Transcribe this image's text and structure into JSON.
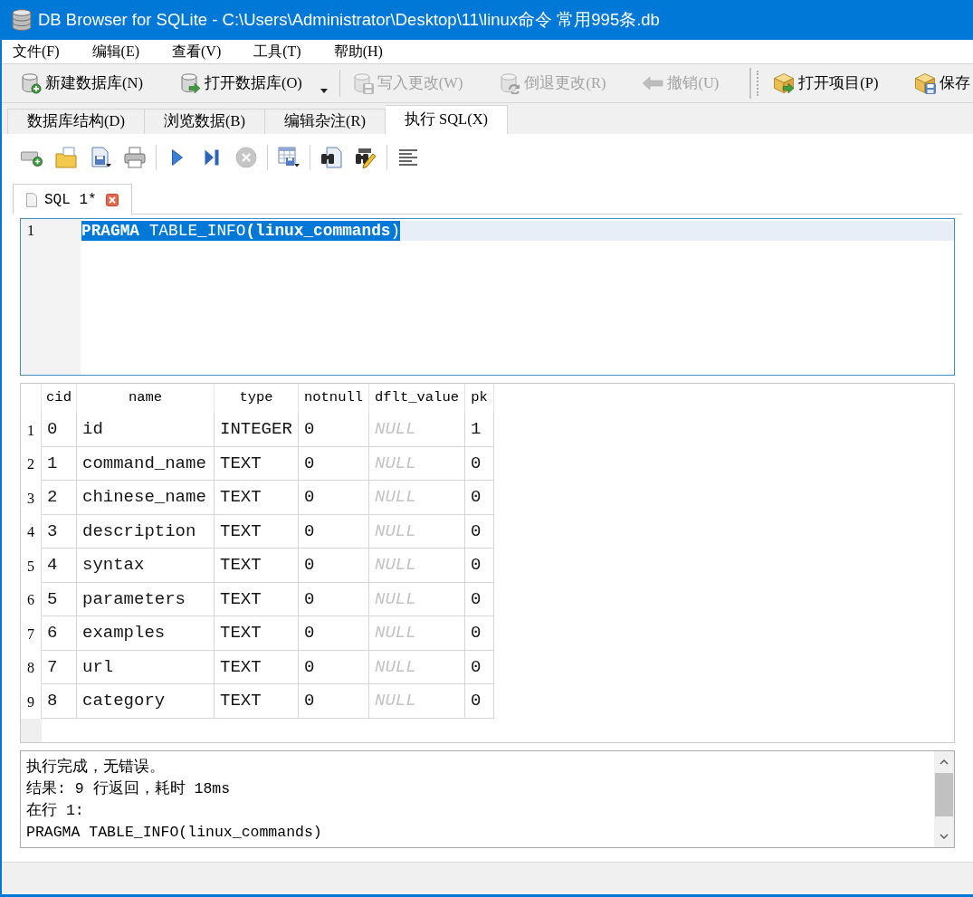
{
  "window": {
    "title": "DB Browser for SQLite - C:\\Users\\Administrator\\Desktop\\11\\linux命令 常用995条.db"
  },
  "menu": [
    "文件(F)",
    "编辑(E)",
    "查看(V)",
    "工具(T)",
    "帮助(H)"
  ],
  "toolbars": [
    {
      "groups": [
        {
          "items": [
            {
              "label": "新建数据库(N)",
              "kind": "button",
              "disabled": false
            },
            {
              "label": "打开数据库(O)",
              "kind": "menu_button",
              "disabled": false
            }
          ]
        },
        {
          "items": [
            {
              "label": "写入更改(W)",
              "kind": "button",
              "disabled": true
            },
            {
              "label": "倒退更改(R)",
              "kind": "button",
              "disabled": true
            },
            {
              "label": "撤销(U)",
              "kind": "button",
              "disabled": true
            }
          ]
        }
      ]
    },
    {
      "groups": [
        {
          "items": [
            {
              "label": "打开项目(P)",
              "kind": "button",
              "disabled": false
            },
            {
              "label": "保存",
              "kind": "button",
              "disabled": false
            }
          ]
        }
      ]
    }
  ],
  "tabs": [
    {
      "label": "数据库结构(D)",
      "selected": false
    },
    {
      "label": "浏览数据(B)",
      "selected": false
    },
    {
      "label": "编辑杂注(R)",
      "selected": false
    },
    {
      "label": "执行 SQL(X)",
      "selected": true
    }
  ],
  "sql_toolbar": [
    {
      "buttons": [
        {
          "disabled": false
        },
        {
          "disabled": false
        },
        {
          "disabled": false
        },
        {
          "disabled": false
        }
      ]
    },
    {
      "buttons": [
        {
          "disabled": false
        },
        {
          "disabled": false
        },
        {
          "disabled": true
        }
      ]
    },
    {
      "buttons": [
        {
          "disabled": false
        }
      ]
    },
    {
      "buttons": [
        {
          "disabled": false
        },
        {
          "disabled": false
        }
      ]
    },
    {
      "buttons": [
        {
          "disabled": false
        }
      ]
    }
  ],
  "editor_tabs": [
    {
      "label": "SQL 1*",
      "selected": true
    }
  ],
  "editor": {
    "lines": [
      {
        "number": "1",
        "text": "**PRAGMA** TABLE_INFO**(linux_commands**)",
        "current": true,
        "selected": true
      }
    ]
  },
  "results": {
    "columns": [
      "cid",
      "name",
      "type",
      "notnull",
      "dflt_value",
      "pk"
    ],
    "rows": [
      {
        "number": "1",
        "cells": [
          {
            "text": "0",
            "kind": "value"
          },
          {
            "text": "id",
            "kind": "value"
          },
          {
            "text": "INTEGER",
            "kind": "value"
          },
          {
            "text": "0",
            "kind": "value"
          },
          {
            "text": "NULL",
            "kind": "null"
          },
          {
            "text": "1",
            "kind": "value"
          }
        ]
      },
      {
        "number": "2",
        "cells": [
          {
            "text": "1",
            "kind": "value"
          },
          {
            "text": "command_name",
            "kind": "value"
          },
          {
            "text": "TEXT",
            "kind": "value"
          },
          {
            "text": "0",
            "kind": "value"
          },
          {
            "text": "NULL",
            "kind": "null"
          },
          {
            "text": "0",
            "kind": "value"
          }
        ]
      },
      {
        "number": "3",
        "cells": [
          {
            "text": "2",
            "kind": "value"
          },
          {
            "text": "chinese_name",
            "kind": "value"
          },
          {
            "text": "TEXT",
            "kind": "value"
          },
          {
            "text": "0",
            "kind": "value"
          },
          {
            "text": "NULL",
            "kind": "null"
          },
          {
            "text": "0",
            "kind": "value"
          }
        ]
      },
      {
        "number": "4",
        "cells": [
          {
            "text": "3",
            "kind": "value"
          },
          {
            "text": "description",
            "kind": "value"
          },
          {
            "text": "TEXT",
            "kind": "value"
          },
          {
            "text": "0",
            "kind": "value"
          },
          {
            "text": "NULL",
            "kind": "null"
          },
          {
            "text": "0",
            "kind": "value"
          }
        ]
      },
      {
        "number": "5",
        "cells": [
          {
            "text": "4",
            "kind": "value"
          },
          {
            "text": "syntax",
            "kind": "value"
          },
          {
            "text": "TEXT",
            "kind": "value"
          },
          {
            "text": "0",
            "kind": "value"
          },
          {
            "text": "NULL",
            "kind": "null"
          },
          {
            "text": "0",
            "kind": "value"
          }
        ]
      },
      {
        "number": "6",
        "cells": [
          {
            "text": "5",
            "kind": "value"
          },
          {
            "text": "parameters",
            "kind": "value"
          },
          {
            "text": "TEXT",
            "kind": "value"
          },
          {
            "text": "0",
            "kind": "value"
          },
          {
            "text": "NULL",
            "kind": "null"
          },
          {
            "text": "0",
            "kind": "value"
          }
        ]
      },
      {
        "number": "7",
        "cells": [
          {
            "text": "6",
            "kind": "value"
          },
          {
            "text": "examples",
            "kind": "value"
          },
          {
            "text": "TEXT",
            "kind": "value"
          },
          {
            "text": "0",
            "kind": "value"
          },
          {
            "text": "NULL",
            "kind": "null"
          },
          {
            "text": "0",
            "kind": "value"
          }
        ]
      },
      {
        "number": "8",
        "cells": [
          {
            "text": "7",
            "kind": "value"
          },
          {
            "text": "url",
            "kind": "value"
          },
          {
            "text": "TEXT",
            "kind": "value"
          },
          {
            "text": "0",
            "kind": "value"
          },
          {
            "text": "NULL",
            "kind": "null"
          },
          {
            "text": "0",
            "kind": "value"
          }
        ]
      },
      {
        "number": "9",
        "cells": [
          {
            "text": "8",
            "kind": "value"
          },
          {
            "text": "category",
            "kind": "value"
          },
          {
            "text": "TEXT",
            "kind": "value"
          },
          {
            "text": "0",
            "kind": "value"
          },
          {
            "text": "NULL",
            "kind": "null"
          },
          {
            "text": "0",
            "kind": "value"
          }
        ]
      }
    ]
  },
  "messages": {
    "lines": [
      "执行完成，无错误。",
      "结果: 9 行返回，耗时 18ms",
      "在行 1:",
      "PRAGMA TABLE_INFO(linux_commands)"
    ]
  }
}
